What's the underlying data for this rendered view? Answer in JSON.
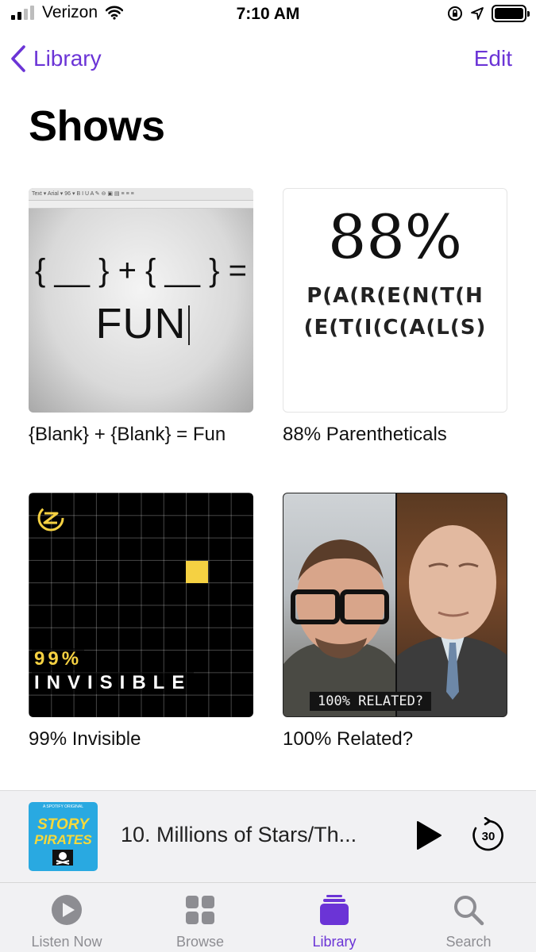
{
  "status_bar": {
    "carrier": "Verizon",
    "time": "7:10 AM",
    "signal_bars_filled": 2,
    "signal_bars_total": 4,
    "battery_level": 1.0
  },
  "nav": {
    "back_label": "Library",
    "edit_label": "Edit",
    "back_icon": "chevron-left-icon"
  },
  "page": {
    "title": "Shows"
  },
  "shows": [
    {
      "label": "{Blank} + {Blank} = Fun",
      "art_equation": "{ __ } + { __ } =",
      "art_word": "FUN",
      "art_toolbar": "Text ▾  Arial ▾  96 ▾  B  I  U  A ✎  ⊖ ▣ ▤ ≡ ≡ ≡"
    },
    {
      "label": "88% Parentheticals",
      "art_percent": "88%",
      "art_line1": "P(A(R(E(N(T(H",
      "art_line2": "(E(T(I(C(A(L(S)"
    },
    {
      "label": "99% Invisible",
      "art_line1": "99%",
      "art_line2": "INVISIBLE"
    },
    {
      "label": "100% Related?",
      "art_caption": "100% RELATED?"
    }
  ],
  "mini_player": {
    "episode_title": "10. Millions of Stars/Th...",
    "art_top_text": "A SPOTIFY ORIGINAL",
    "art_line1": "STORY",
    "art_line2": "PIRATES",
    "skip_seconds": "30"
  },
  "tabs": [
    {
      "label": "Listen Now",
      "icon": "play-circle-icon",
      "active": false
    },
    {
      "label": "Browse",
      "icon": "grid-icon",
      "active": false
    },
    {
      "label": "Library",
      "icon": "library-stack-icon",
      "active": true
    },
    {
      "label": "Search",
      "icon": "search-icon",
      "active": false
    }
  ],
  "colors": {
    "accent": "#6b34d6",
    "tab_inactive": "#8d8d92",
    "invisible_yellow": "#f5d142"
  }
}
